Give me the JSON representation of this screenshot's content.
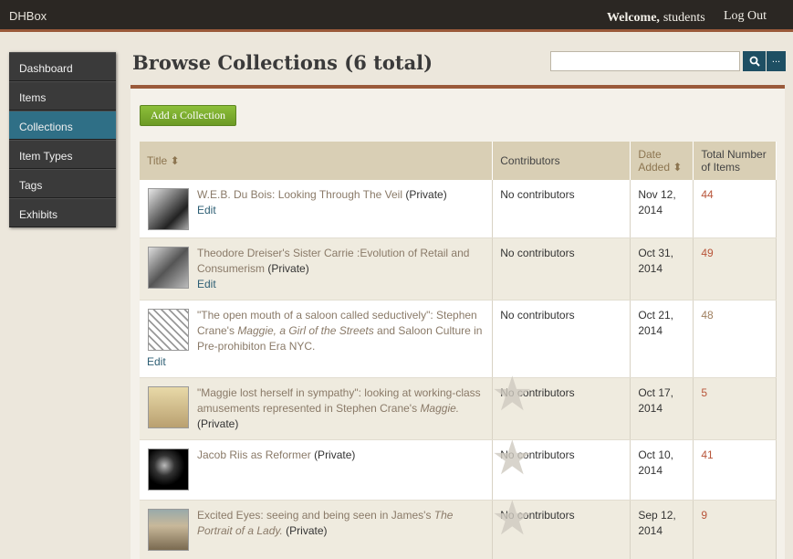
{
  "topbar": {
    "brand": "DHBox",
    "welcome_label": "Welcome,",
    "username": "students",
    "logout": "Log Out"
  },
  "sidebar": {
    "items": [
      {
        "label": "Dashboard",
        "active": false
      },
      {
        "label": "Items",
        "active": false
      },
      {
        "label": "Collections",
        "active": true
      },
      {
        "label": "Item Types",
        "active": false
      },
      {
        "label": "Tags",
        "active": false
      },
      {
        "label": "Exhibits",
        "active": false
      }
    ]
  },
  "main": {
    "title": "Browse Collections (6 total)",
    "search": {
      "placeholder": "",
      "value": "",
      "more_label": "..."
    },
    "add_button": "Add a Collection",
    "columns": {
      "title": "Title",
      "contributors": "Contributors",
      "date_added": "Date Added",
      "total_items": "Total Number of Items"
    },
    "rows": [
      {
        "title": "W.E.B. Du Bois: Looking Through The Veil",
        "title_italic": "",
        "title_after": "",
        "private": "(Private)",
        "edit": "Edit",
        "contributors": "No contributors",
        "date": "Nov 12, 2014",
        "total": "44"
      },
      {
        "title": "Theodore Dreiser's Sister Carrie :Evolution of Retail and Consumerism",
        "title_italic": "",
        "title_after": "",
        "private": "(Private)",
        "edit": "Edit",
        "contributors": "No contributors",
        "date": "Oct 31, 2014",
        "total": "49"
      },
      {
        "title": "\"The open mouth of a saloon called seductively\": Stephen Crane's ",
        "title_italic": "Maggie, a Girl of the Streets",
        "title_after": " and Saloon Culture in Pre-prohibiton Era NYC.",
        "private": "",
        "edit": "Edit",
        "contributors": "No contributors",
        "date": "Oct 21, 2014",
        "total": "48"
      },
      {
        "title": "\"Maggie lost herself in sympathy\": looking at working-class amusements represented in Stephen Crane's ",
        "title_italic": "Maggie.",
        "title_after": "",
        "private": "(Private)",
        "edit": "",
        "contributors": "No contributors",
        "date": "Oct 17, 2014",
        "total": "5"
      },
      {
        "title": "Jacob Riis as Reformer",
        "title_italic": "",
        "title_after": "",
        "private": "(Private)",
        "edit": "",
        "contributors": "No contributors",
        "date": "Oct 10, 2014",
        "total": "41"
      },
      {
        "title": "Excited Eyes: seeing and being seen in James's ",
        "title_italic": "The Portrait of a Lady.",
        "title_after": "",
        "private": "(Private)",
        "edit": "",
        "contributors": "No contributors",
        "date": "Sep 12, 2014",
        "total": "9"
      }
    ]
  },
  "colors": {
    "topbar": "#2b2723",
    "accent": "#9a5a3a",
    "active_nav": "#2f6f86",
    "add_button": "#7aab2e",
    "count_link": "#b8553a"
  }
}
